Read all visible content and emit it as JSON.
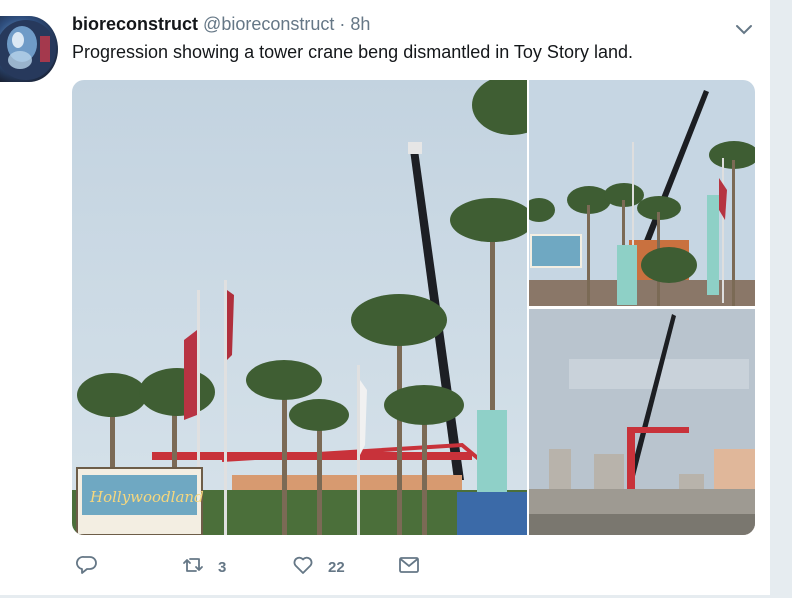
{
  "tweet": {
    "display_name": "bioreconstruct",
    "handle": "@bioreconstruct",
    "separator": "·",
    "timestamp": "8h",
    "text": "Progression showing a tower crane beng dismantled in Toy Story land.",
    "media": {
      "count": 3,
      "sign_text": "Hollywoodland"
    }
  },
  "actions": {
    "reply": {
      "icon": "reply-icon"
    },
    "retweet": {
      "icon": "retweet-icon",
      "count": "3"
    },
    "like": {
      "icon": "heart-icon",
      "count": "22"
    },
    "message": {
      "icon": "envelope-icon"
    }
  },
  "colors": {
    "text": "#14171a",
    "secondary": "#657786",
    "border": "#e6ecf0",
    "sky": "#c8d7e3"
  }
}
